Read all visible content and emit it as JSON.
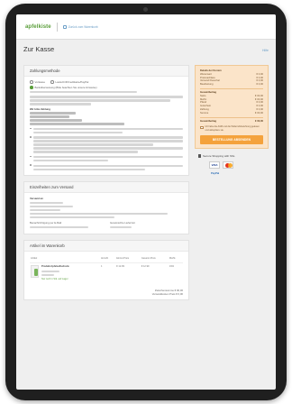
{
  "header": {
    "logo": "apfelkiste",
    "back_link": "Zurück zum Warenkorb"
  },
  "page": {
    "title": "Zur Kasse",
    "help": "Hilfe"
  },
  "payment": {
    "heading": "Zahlungsmethode",
    "options": [
      "Vorkasse",
      "Lastschrift/Kreditkarte/PayPal",
      "Banküberweisung (Bitte beachten Sie unsere Hinweise)"
    ],
    "selected_index": 2,
    "bank_title": "Wir bitte Zahlung"
  },
  "shipping": {
    "heading": "Einzelheiten zum Versand",
    "label_address": "Versand an",
    "label_phone": "Benachrichtigung per E-Mail",
    "label_delivery": "Gewünschte Lieferzeit"
  },
  "items": {
    "heading": "Artikel im Warenkorb",
    "columns": [
      "Artikel",
      "Anzahl",
      "Einzel-Preis",
      "Gesamt-Preis",
      "MwSt."
    ],
    "rows": [
      {
        "name": "Produkt Apfelsaftschorle",
        "qty": "1",
        "unit": "€ 12.99",
        "total": "€ 12.99",
        "tax": "19%",
        "stock": "Nur noch 1 Stk. auf Lager"
      }
    ],
    "footer_total": "Zwischensumme € 00,00",
    "footer_note": "Versandkosten Preis € 0,00"
  },
  "summary": {
    "heading": "Details der Kosten",
    "rows_top": [
      {
        "label": "Warenwert",
        "value": "€ 0,00"
      },
      {
        "label": "Preisnachlass",
        "value": "€ 0,00"
      },
      {
        "label": "Versand Pauschal",
        "value": "€ 0,00"
      },
      {
        "label": "Bearbeitung",
        "value": "€ 0,00"
      }
    ],
    "block_heading": "Gesamtbetrag",
    "rows_mid": [
      {
        "label": "Netto",
        "value": "€ 00,00"
      },
      {
        "label": "MwSt.",
        "value": "€ 00,00"
      },
      {
        "label": "Pfand",
        "value": "€ 0,00"
      },
      {
        "label": "Gutschein",
        "value": "€ 0,00"
      },
      {
        "label": "Zahlung",
        "value": "€ 0,00"
      },
      {
        "label": "Summe",
        "value": "€ 00,00"
      }
    ],
    "total_label": "Gesamtbetrag",
    "total_value": "€ 00,00",
    "terms": "Ich habe die AGB und die Widerrufsbelehrung gelesen und akzeptiere sie.",
    "order_button": "BESTELLUNG ABSENDEN"
  },
  "secure": {
    "label": "Secure Shopping with SSL",
    "visa": "VISA",
    "paypal": "PayPal"
  },
  "colors": {
    "brand_green": "#5a9e3a",
    "order_orange": "#f4a23c",
    "summary_bg": "#fbe4c9"
  }
}
